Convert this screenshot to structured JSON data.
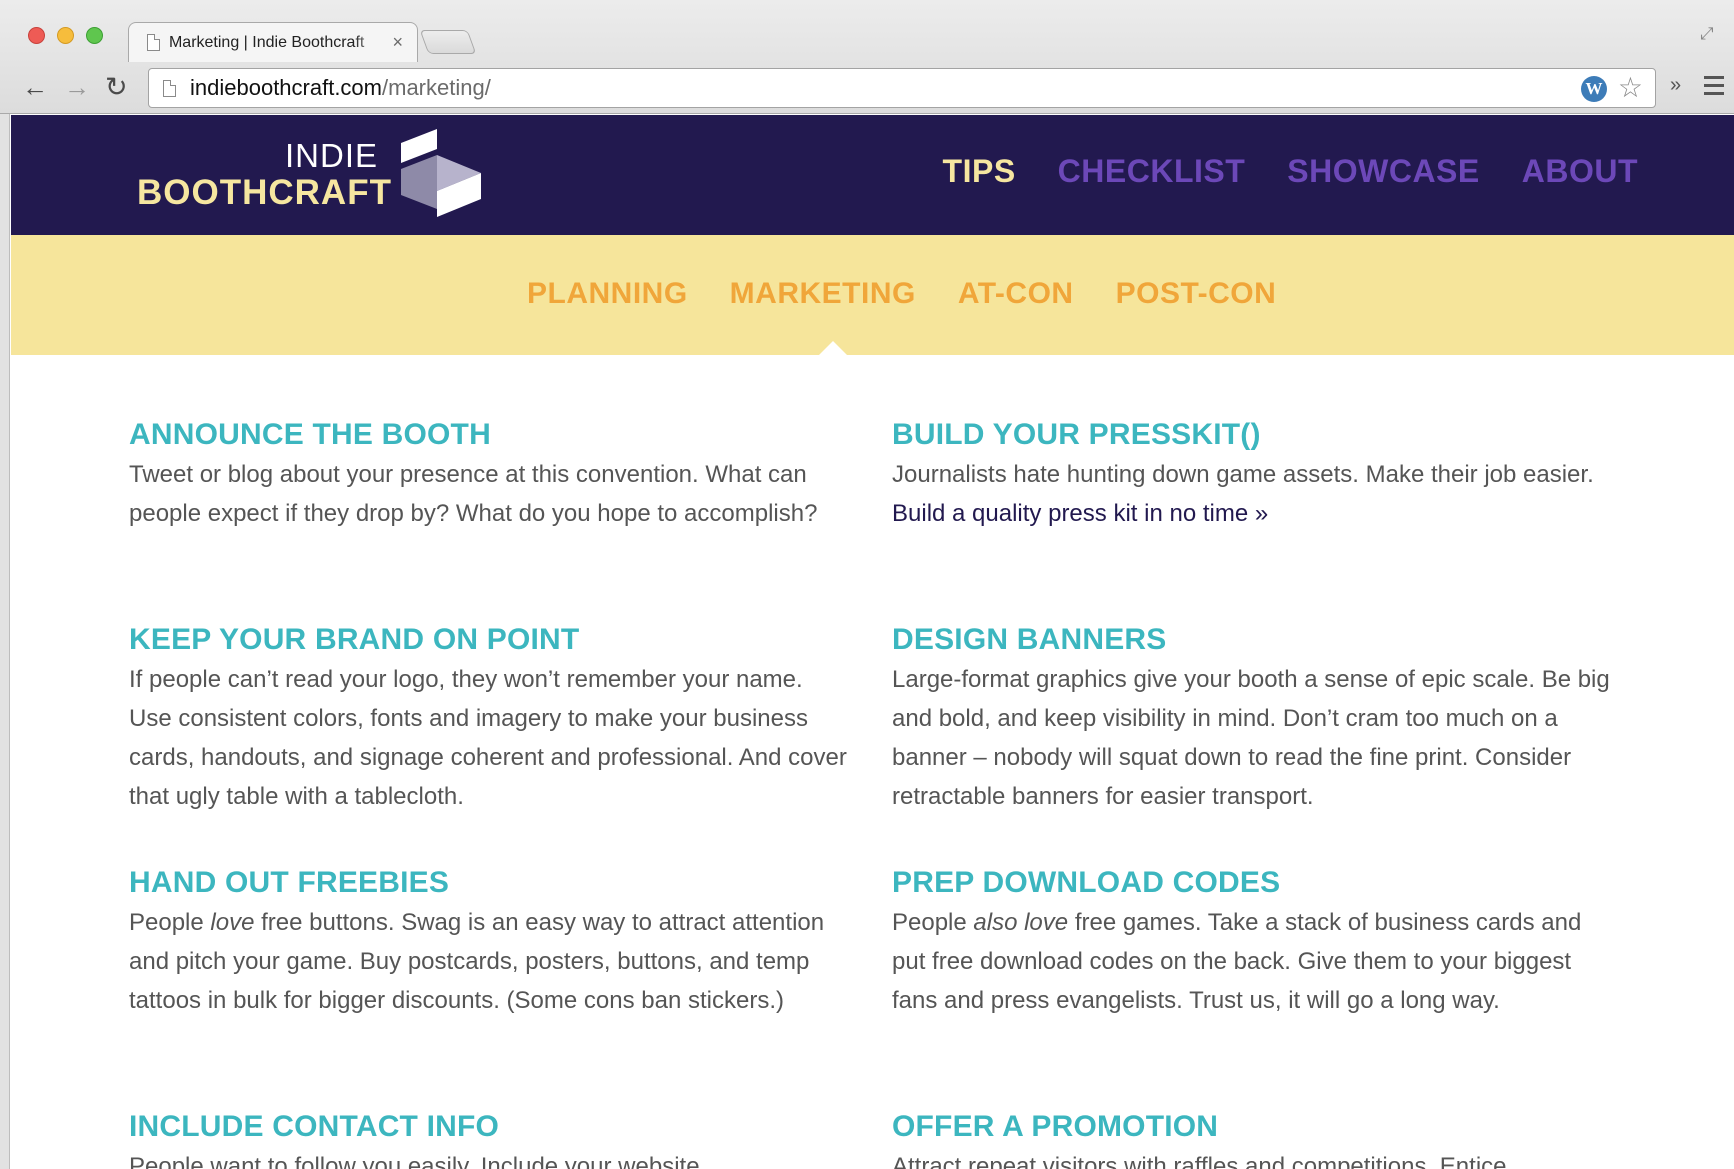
{
  "browser": {
    "tab_title": "Marketing | Indie Boothcraft",
    "tab_close": "×",
    "url_domain": "indieboothcraft.com",
    "url_path": "/marketing/",
    "back_icon": "←",
    "forward_icon": "→",
    "reload_icon": "↻",
    "extensions_chevron": "»",
    "star_icon": "☆",
    "wordpress_icon": "W",
    "fullscreen_icon": "⤢"
  },
  "logo": {
    "line1": "INDIE",
    "line2": "BOOTHCRAFT"
  },
  "main_nav": [
    {
      "label": "TIPS",
      "active": true
    },
    {
      "label": "CHECKLIST",
      "active": false
    },
    {
      "label": "SHOWCASE",
      "active": false
    },
    {
      "label": "ABOUT",
      "active": false
    }
  ],
  "sub_nav": [
    {
      "label": "PLANNING"
    },
    {
      "label": "MARKETING",
      "active": true
    },
    {
      "label": "AT-CON"
    },
    {
      "label": "POST-CON"
    }
  ],
  "tips": {
    "announce": {
      "title": "ANNOUNCE THE BOOTH",
      "body": "Tweet or blog about your presence at this convention. What can people expect if they drop by? What do you hope to accomplish?"
    },
    "presskit": {
      "title": "BUILD YOUR PRESSKIT()",
      "body": "Journalists hate hunting down game assets. Make their job easier.",
      "link": "Build a quality press kit in no time »"
    },
    "brand": {
      "title": "KEEP YOUR BRAND ON POINT",
      "body": "If people can’t read your logo, they won’t remember your name. Use consistent colors, fonts and imagery to make your business cards, handouts, and signage coherent and professional. And cover that ugly table with a tablecloth."
    },
    "banners": {
      "title": "DESIGN BANNERS",
      "body": "Large-format graphics give your booth a sense of epic scale. Be big and bold, and keep visibility in mind. Don’t cram too much on a banner – nobody will squat down to read the fine print. Consider retractable banners for easier transport."
    },
    "freebies": {
      "title": "HAND OUT FREEBIES",
      "body_before": "People",
      "body_em": "love",
      "body_after": "free buttons. Swag is an easy way to attract attention and pitch your game. Buy postcards, posters, buttons, and temp tattoos in bulk for bigger discounts. (Some cons ban stickers.)"
    },
    "codes": {
      "title": "PREP DOWNLOAD CODES",
      "body_before": "People",
      "body_em": "also love",
      "body_after": "free games. Take a stack of business cards and put free download codes on the back. Give them to your biggest fans and press evangelists. Trust us, it will go a long way."
    },
    "contact": {
      "title": "INCLUDE CONTACT INFO",
      "body": "People want to follow you easily. Include your website"
    },
    "promotion": {
      "title": "OFFER A PROMOTION",
      "body": "Attract repeat visitors with raffles and competitions. Entice"
    }
  },
  "colors": {
    "header_bg": "#22194f",
    "nav_inactive": "#6c48b8",
    "nav_active": "#f6e6a0",
    "subnav_bg": "#f6e59b",
    "subnav_text": "#f0a63a",
    "heading_teal": "#3cb6bf",
    "body_text": "#555555"
  }
}
